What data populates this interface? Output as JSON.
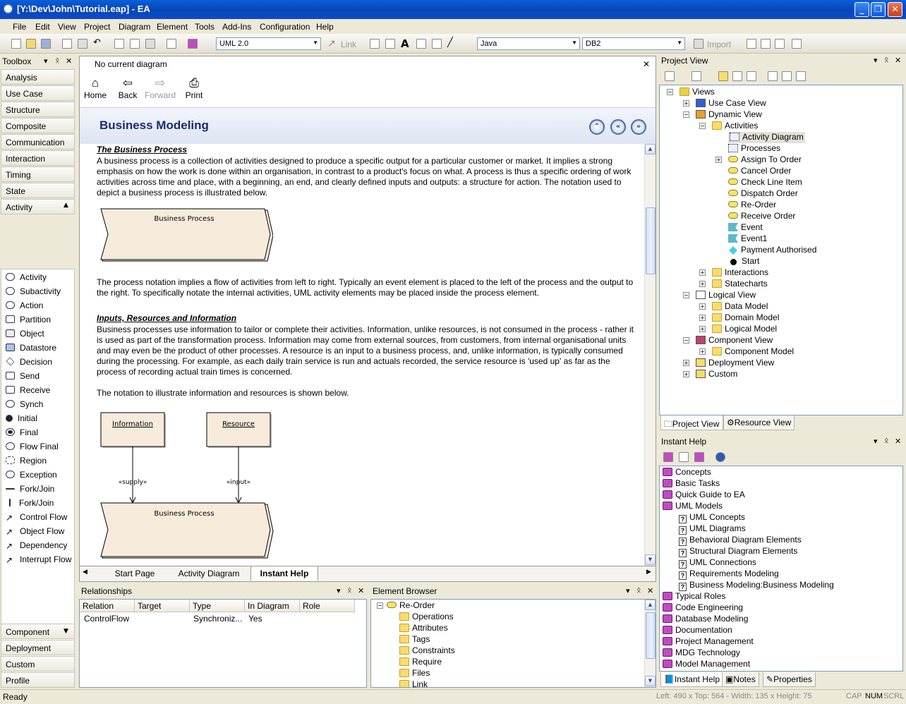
{
  "title": "[Y:\\Dev\\John\\Tutorial.eap] - EA",
  "menu": [
    "File",
    "Edit",
    "View",
    "Project",
    "Diagram",
    "Element",
    "Tools",
    "Add-Ins",
    "Configuration",
    "Help"
  ],
  "toolbar": {
    "uml": "UML 2.0",
    "link": "Link",
    "language": "Java",
    "db": "DB2",
    "import": "Import"
  },
  "toolbox": {
    "title": "Toolbox",
    "categories": [
      "Analysis",
      "Use Case",
      "Structure",
      "Composite",
      "Communication",
      "Interaction",
      "Timing",
      "State",
      "Activity"
    ],
    "items": [
      "Activity",
      "Subactivity",
      "Action",
      "Partition",
      "Object",
      "Datastore",
      "Decision",
      "Send",
      "Receive",
      "Synch",
      "Initial",
      "Final",
      "Flow Final",
      "Region",
      "Exception",
      "Fork/Join",
      "Fork/Join",
      "Control Flow",
      "Object Flow",
      "Dependency",
      "Interrupt Flow"
    ],
    "bottom": [
      "Component",
      "Deployment",
      "Custom",
      "Profile"
    ]
  },
  "doc": {
    "header": "No current diagram",
    "nav": [
      "Home",
      "Back",
      "Forward",
      "Print"
    ],
    "heading": "Business Modeling",
    "h_process": "The Business Process",
    "p1": "A business process is a collection of activities designed to produce a specific output for a particular customer or market. It implies a strong emphasis on how the work is done within an organisation, in contrast to a product's focus on what. A process is thus a specific ordering of work activities across time and place, with a beginning, an end, and clearly defined inputs and outputs: a structure for action. The notation used to depict a business process is illustrated below.",
    "shape_label": "Business Process",
    "p2": "The process notation implies a flow of activities from left to right. Typically an event element is placed to the left of the process and the output to the right. To specifically notate the internal activities, UML activity elements may be placed inside the process element.",
    "h_inputs": "Inputs, Resources and Information",
    "p3": "Business processes use information to tailor or complete their activities. Information, unlike resources, is not consumed in the process - rather it is used as part of the transformation process. Information may come from external sources, from customers, from internal organisational units and may even be the product of other processes. A resource is an input to a business process, and, unlike information, is typically consumed during the processing. For example, as each daily train service is run and actuals recorded, the service resource is 'used up' as far as the process of recording actual train times is concerned.",
    "p4": "The notation to illustrate information and resources is shown below.",
    "info": "Information",
    "resource": "Resource",
    "supply": "«supply»",
    "input": "«input»",
    "bp2": "Business Process",
    "tabs": [
      "Start Page",
      "Activity Diagram",
      "Instant Help"
    ]
  },
  "relationships": {
    "title": "Relationships",
    "cols": [
      "Relation",
      "Target",
      "Type",
      "In Diagram",
      "Role"
    ],
    "row": [
      "ControlFlow",
      "",
      "Synchroniz...",
      "Yes",
      ""
    ]
  },
  "element_browser": {
    "title": "Element Browser",
    "root": "Re-Order",
    "items": [
      "Operations",
      "Attributes",
      "Tags",
      "Constraints",
      "Require",
      "Files",
      "Link"
    ]
  },
  "project_view": {
    "title": "Project View",
    "tree": [
      {
        "t": "Views",
        "d": 0
      },
      {
        "t": "Use Case View",
        "d": 1
      },
      {
        "t": "Dynamic View",
        "d": 1
      },
      {
        "t": "Activities",
        "d": 2
      },
      {
        "t": "Activity Diagram",
        "d": 3
      },
      {
        "t": "Processes",
        "d": 3
      },
      {
        "t": "Assign To Order",
        "d": 3
      },
      {
        "t": "Cancel Order",
        "d": 3
      },
      {
        "t": "Check Line Item",
        "d": 3
      },
      {
        "t": "Dispatch Order",
        "d": 3
      },
      {
        "t": "Re-Order",
        "d": 3
      },
      {
        "t": "Receive Order",
        "d": 3
      },
      {
        "t": "Event",
        "d": 3
      },
      {
        "t": "Event1",
        "d": 3
      },
      {
        "t": "Payment Authorised",
        "d": 3
      },
      {
        "t": "Start",
        "d": 3
      },
      {
        "t": "Interactions",
        "d": 2
      },
      {
        "t": "Statecharts",
        "d": 2
      },
      {
        "t": "Logical View",
        "d": 1
      },
      {
        "t": "Data Model",
        "d": 2
      },
      {
        "t": "Domain Model",
        "d": 2
      },
      {
        "t": "Logical Model",
        "d": 2
      },
      {
        "t": "Component View",
        "d": 1
      },
      {
        "t": "Component Model",
        "d": 2
      },
      {
        "t": "Deployment View",
        "d": 1
      },
      {
        "t": "Custom",
        "d": 1
      }
    ],
    "tabs": [
      "Project View",
      "Resource View"
    ]
  },
  "instant_help": {
    "title": "Instant Help",
    "items": [
      {
        "t": "Concepts",
        "d": 0
      },
      {
        "t": "Basic Tasks",
        "d": 0
      },
      {
        "t": "Quick Guide to EA",
        "d": 0
      },
      {
        "t": "UML Models",
        "d": 0
      },
      {
        "t": "UML Concepts",
        "d": 1
      },
      {
        "t": "UML Diagrams",
        "d": 1
      },
      {
        "t": "Behavioral Diagram Elements",
        "d": 1
      },
      {
        "t": "Structural Diagram Elements",
        "d": 1
      },
      {
        "t": "UML Connections",
        "d": 1
      },
      {
        "t": "Requirements Modeling",
        "d": 1
      },
      {
        "t": "Business Modeling:Business Modeling",
        "d": 1
      },
      {
        "t": "Typical Roles",
        "d": 0
      },
      {
        "t": "Code Engineering",
        "d": 0
      },
      {
        "t": "Database Modeling",
        "d": 0
      },
      {
        "t": "Documentation",
        "d": 0
      },
      {
        "t": "Project Management",
        "d": 0
      },
      {
        "t": "MDG Technology",
        "d": 0
      },
      {
        "t": "Model Management",
        "d": 0
      }
    ],
    "tabs": [
      "Instant Help",
      "Notes",
      "Properties"
    ]
  },
  "status": {
    "left": "Ready",
    "coords": "Left:  490 x Top:  564 - Width:  135 x Height:  75",
    "cap": "CAP",
    "num": "NUM",
    "scrl": "SCRL"
  }
}
